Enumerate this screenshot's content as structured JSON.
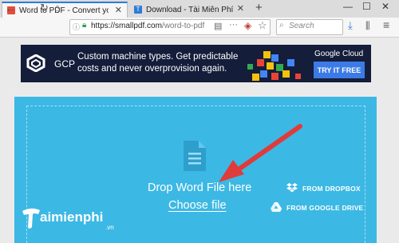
{
  "browser": {
    "tabs": [
      {
        "title": "Word to PDF - Convert your DOC",
        "active": true
      },
      {
        "title": "Download - Tài Miễn Phí VN -",
        "active": false
      }
    ],
    "new_tab": "+",
    "url": {
      "host": "https://smallpdf.com",
      "path": "/word-to-pdf"
    },
    "search_placeholder": "Search",
    "window_controls": [
      "minimize-icon",
      "maximize-icon",
      "close-icon"
    ]
  },
  "ad": {
    "brand": "GCP",
    "copy": "Custom machine types. Get predictable costs and never overprovision again.",
    "sponsor": "Google Cloud",
    "cta": "TRY IT FREE"
  },
  "upload": {
    "drop_label": "Drop Word File here",
    "choose_label": "Choose file",
    "sources": [
      {
        "label": "FROM DROPBOX",
        "icon": "dropbox-icon"
      },
      {
        "label": "FROM GOOGLE DRIVE",
        "icon": "google-drive-icon"
      }
    ]
  },
  "watermark": {
    "text": "aimienphi",
    "suffix": ".vn"
  },
  "colors": {
    "accent_blue": "#3cb8e4",
    "ad_bg": "#141d3a",
    "cta_blue": "#3c7be6",
    "arrow_red": "#e03b3b"
  }
}
